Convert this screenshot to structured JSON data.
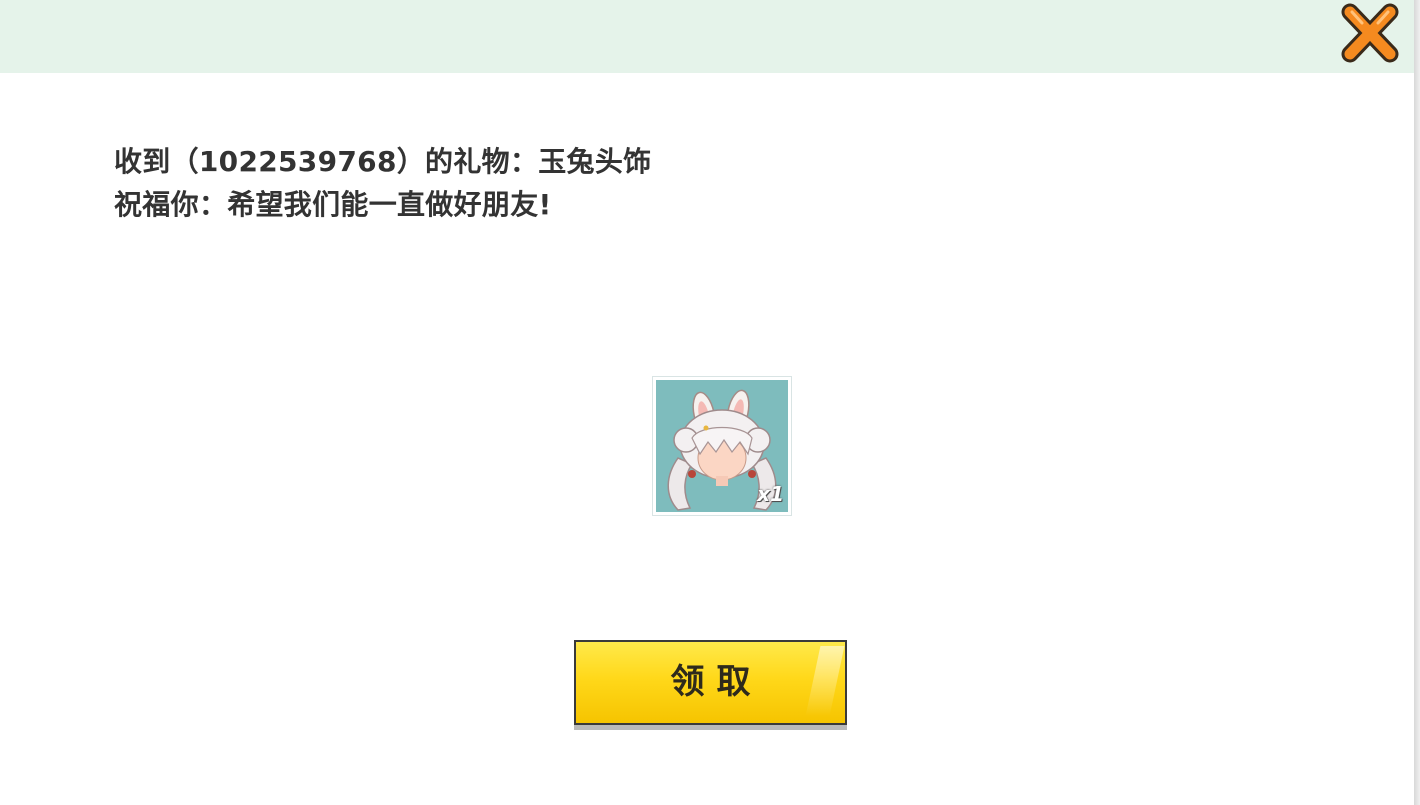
{
  "header": {
    "close_icon": "close-x-icon",
    "accent_color": "#e5f3ea",
    "close_color": "#f58a1f"
  },
  "message": {
    "line1": "收到（1022539768）的礼物：玉兔头饰",
    "line2": "祝福你：希望我们能一直做好朋友!"
  },
  "gift": {
    "icon": "rabbit-ear-headwear-icon",
    "quantity": "x1",
    "bg_color": "#7ebcbd"
  },
  "claim_button": {
    "label": "领取",
    "color": "#ffd81a"
  }
}
